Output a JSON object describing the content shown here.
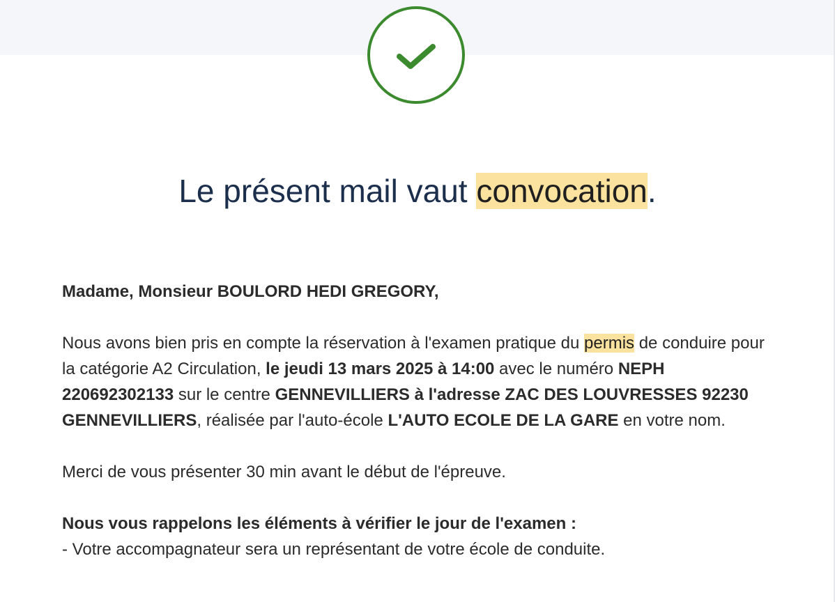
{
  "header": {
    "icon": "check-icon",
    "accent_color": "#3b8a2e",
    "background_color": "#f5f6fa"
  },
  "headline": {
    "before": "Le présent mail vaut ",
    "highlight": "convocation",
    "after": "."
  },
  "greeting": "Madame, Monsieur BOULORD HEDI GREGORY,",
  "reservation": {
    "t1": "Nous avons bien pris en compte la réservation à l'examen pratique du ",
    "hl": "permis",
    "t2": " de conduire pour la catégorie A2 Circulation, ",
    "date": "le jeudi 13 mars 2025 à 14:00",
    "t3": " avec le numéro ",
    "neph": "NEPH 220692302133",
    "t4": " sur le centre ",
    "centre": "GENNEVILLIERS à l'adresse ZAC DES LOUVRESSES 92230 GENNEVILLIERS",
    "t5": ", réalisée par l'auto-école ",
    "school": "L'AUTO ECOLE DE LA GARE",
    "t6": " en votre nom."
  },
  "arrival_notice": "Merci de vous présenter 30 min avant le début de l'épreuve.",
  "reminders": {
    "title": "Nous vous rappelons les éléments à vérifier le jour de l'examen :",
    "items": [
      "- Votre accompagnateur sera un représentant de votre école de conduite."
    ]
  }
}
